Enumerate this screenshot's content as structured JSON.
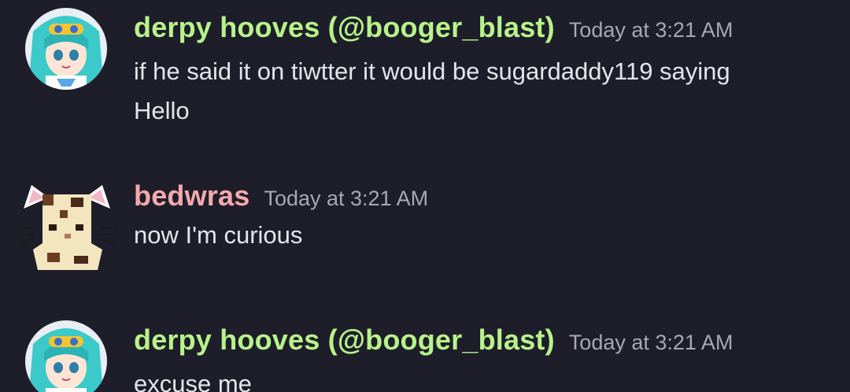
{
  "messages": [
    {
      "author": "derpy hooves (@booger_blast)",
      "author_color": "#b8f28a",
      "timestamp": "Today at 3:21 AM",
      "lines": [
        "if he said it on tiwtter it would be sugardaddy119 saying",
        "Hello"
      ],
      "avatar": "miku-avatar"
    },
    {
      "author": "bedwras",
      "author_color": "#f4a9ae",
      "timestamp": "Today at 3:21 AM",
      "lines": [
        "now I'm curious"
      ],
      "avatar": "cat-block-avatar"
    },
    {
      "author": "derpy hooves (@booger_blast)",
      "author_color": "#b8f28a",
      "timestamp": "Today at 3:21 AM",
      "lines": [
        "excuse me"
      ],
      "avatar": "miku-avatar"
    }
  ]
}
